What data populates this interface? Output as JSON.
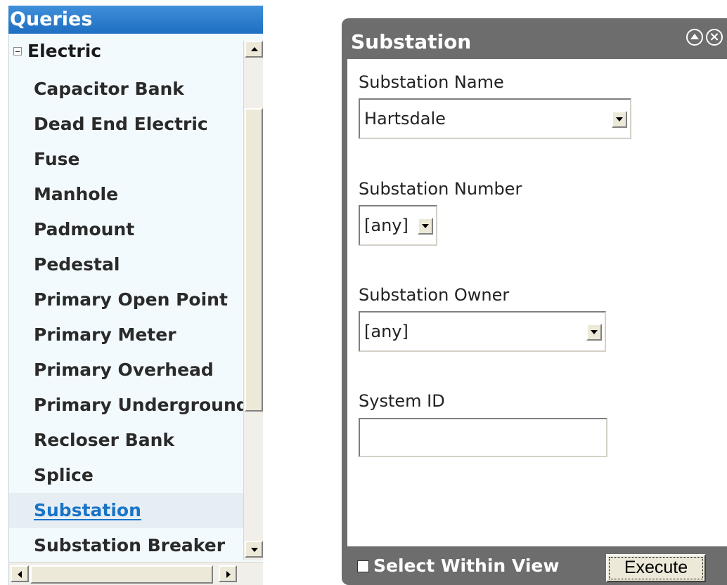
{
  "queries": {
    "header": "Queries",
    "group": {
      "label": "Electric",
      "expanded": true
    },
    "items": [
      {
        "label": "Capacitor Bank"
      },
      {
        "label": "Dead End Electric"
      },
      {
        "label": "Fuse"
      },
      {
        "label": "Manhole"
      },
      {
        "label": "Padmount"
      },
      {
        "label": "Pedestal"
      },
      {
        "label": "Primary Open Point"
      },
      {
        "label": "Primary Meter"
      },
      {
        "label": "Primary Overhead"
      },
      {
        "label": "Primary Underground"
      },
      {
        "label": "Recloser Bank"
      },
      {
        "label": "Splice"
      },
      {
        "label": "Substation",
        "selected": true
      },
      {
        "label": "Substation Breaker"
      }
    ]
  },
  "panel": {
    "title": "Substation",
    "icons": {
      "collapse": "collapse-up-icon",
      "close": "close-icon"
    },
    "fields": {
      "name": {
        "label": "Substation Name",
        "value": "Hartsdale"
      },
      "number": {
        "label": "Substation Number",
        "value": "[any]"
      },
      "owner": {
        "label": "Substation Owner",
        "value": "[any]"
      },
      "system_id": {
        "label": "System ID",
        "value": ""
      }
    },
    "footer": {
      "select_within_view": {
        "label": "Select Within View",
        "checked": false
      },
      "execute_label": "Execute"
    }
  },
  "colors": {
    "header_blue": "#2a7bcf",
    "panel_gray": "#6d6d6d",
    "link_blue": "#1a74c6",
    "list_bg": "#f3fafe"
  }
}
